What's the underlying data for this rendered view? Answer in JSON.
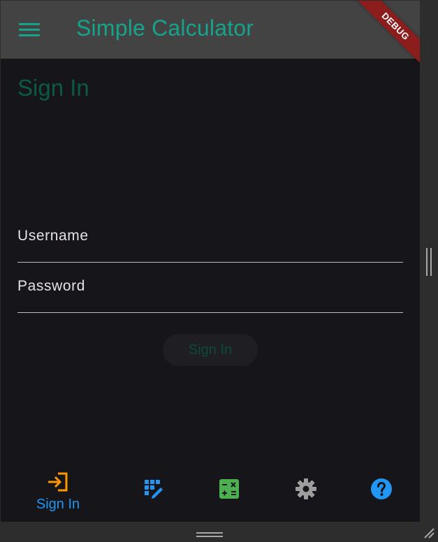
{
  "appbar": {
    "title": "Simple Calculator",
    "debug_banner": "DEBUG"
  },
  "page": {
    "title": "Sign In"
  },
  "form": {
    "username_label": "Username",
    "password_label": "Password",
    "submit_label": "Sign In"
  },
  "bottom_nav": {
    "items": [
      {
        "label": "Sign In",
        "icon": "login-icon",
        "selected": true,
        "color": "#ff9800"
      },
      {
        "label": "",
        "icon": "grid-edit-icon",
        "selected": false,
        "color": "#2196f3"
      },
      {
        "label": "",
        "icon": "calculator-icon",
        "selected": false,
        "color": "#4caf50"
      },
      {
        "label": "",
        "icon": "gear-icon",
        "selected": false,
        "color": "#9e9e9e"
      },
      {
        "label": "",
        "icon": "help-icon",
        "selected": false,
        "color": "#2196f3"
      }
    ]
  },
  "colors": {
    "accent": "#16a38c",
    "appbar_bg": "#434343",
    "body_bg": "#16151a",
    "selected_label": "#2196f3"
  }
}
